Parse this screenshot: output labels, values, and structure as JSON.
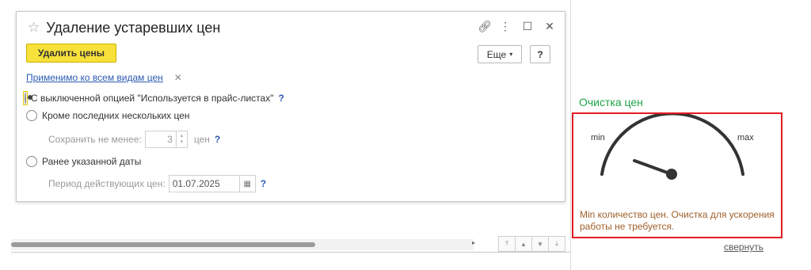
{
  "dialog": {
    "title": "Удаление устаревших цен",
    "primary_button": "Удалить цены",
    "more_button": "Еще",
    "help_button": "?",
    "filter_link": "Применимо ко всем видам цен",
    "options": [
      {
        "label": "С выключенной опцией \"Используется в прайс-листах\"",
        "help": "?",
        "selected": true
      },
      {
        "label": "Кроме последних нескольких цен",
        "selected": false
      },
      {
        "label": "Ранее указанной даты",
        "selected": false
      }
    ],
    "keep_min": {
      "label": "Сохранить не менее:",
      "value": "3",
      "unit": "цен",
      "help": "?"
    },
    "period": {
      "label": "Период действующих цен:",
      "value": "01.07.2025",
      "help": "?"
    }
  },
  "panel": {
    "title": "Очистка цен",
    "gauge": {
      "min_label": "min",
      "max_label": "max",
      "level": 0.0
    },
    "message": "Min количество цен. Очистка для ускорения работы не требуется.",
    "collapse_link": "свернуть"
  },
  "colors": {
    "accent_yellow": "#f7e13a",
    "link_blue": "#2a5ab3",
    "panel_title_green": "#1fa346",
    "panel_border_red": "#e31b23",
    "message_brown": "#a0602a"
  }
}
